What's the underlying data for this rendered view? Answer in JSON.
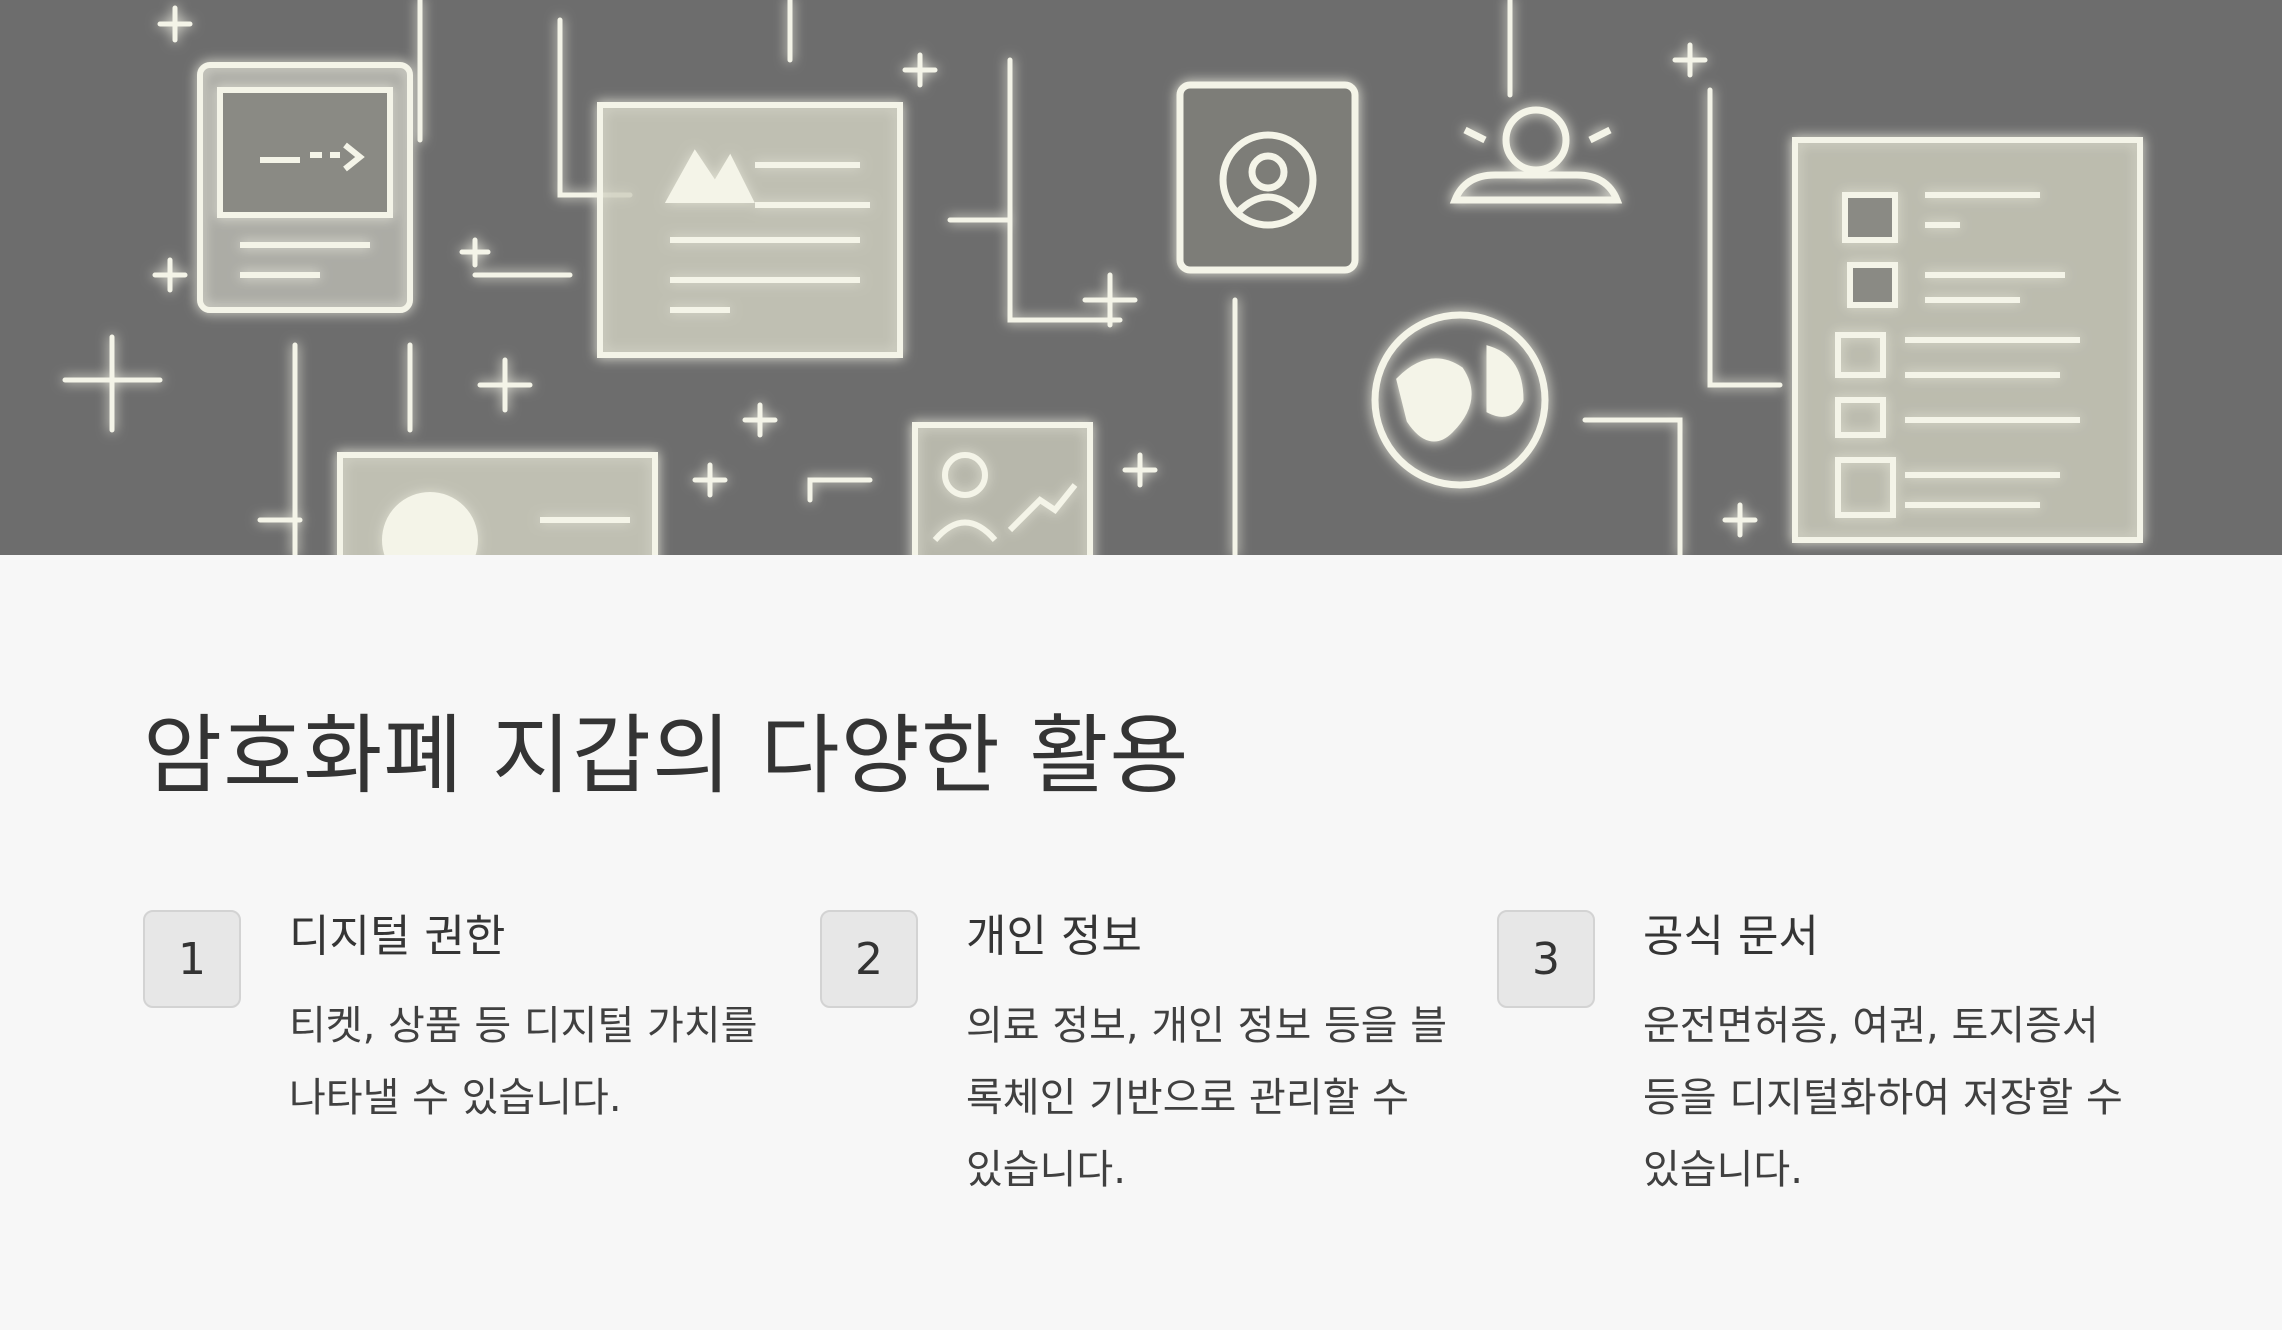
{
  "hero": {
    "icons": [
      "ticket-card-icon",
      "image-document-icon",
      "contact-card-icon",
      "user-profile-icon",
      "globe-icon",
      "form-document-icon",
      "id-card-icon",
      "chart-card-icon"
    ]
  },
  "section": {
    "title": "암호화폐 지갑의 다양한 활용"
  },
  "items": [
    {
      "number": "1",
      "title": "디지털 권한",
      "description": "티켓, 상품 등 디지털 가치를 나타낼 수 있습니다."
    },
    {
      "number": "2",
      "title": "개인 정보",
      "description": "의료 정보, 개인 정보 등을 블록체인 기반으로 관리할 수 있습니다."
    },
    {
      "number": "3",
      "title": "공식 문서",
      "description": "운전면허증, 여권, 토지증서 등을 디지털화하여 저장할 수 있습니다."
    }
  ],
  "colors": {
    "hero_background": "#6d6d6d",
    "sketch_stroke": "#f4f4e8",
    "page_background": "#f7f7f7",
    "badge_background": "#e7e7e7"
  }
}
